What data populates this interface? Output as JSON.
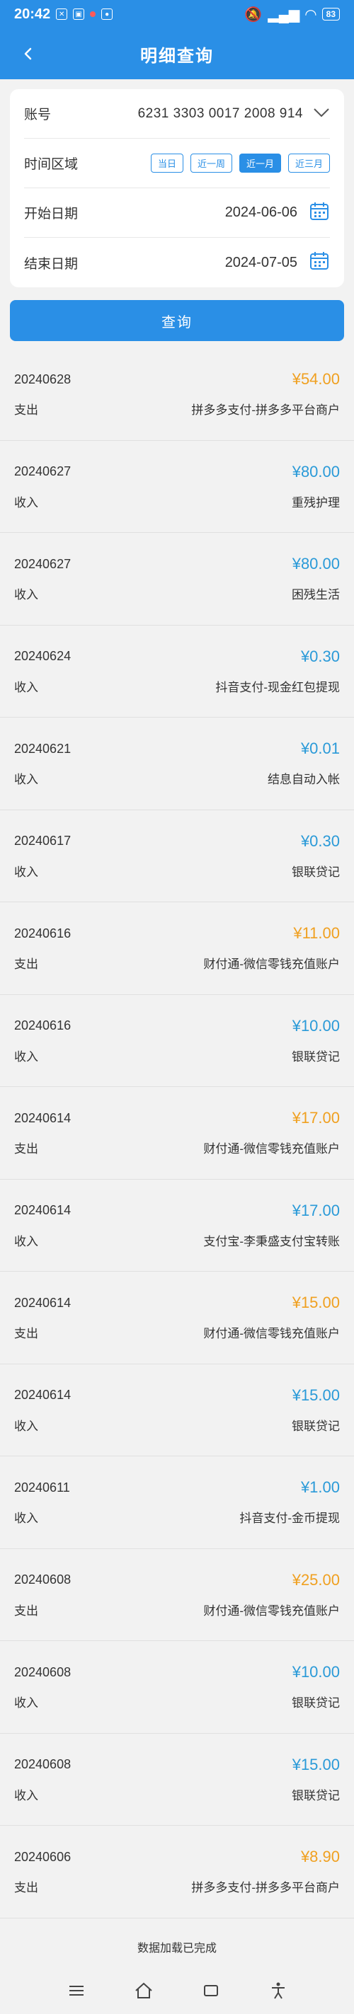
{
  "status_bar": {
    "time": "20:42",
    "battery": "83"
  },
  "header": {
    "title": "明细查询"
  },
  "form": {
    "account_label": "账号",
    "account_value": "6231 3303 0017 2008 914",
    "range_label": "时间区域",
    "range_options": [
      "当日",
      "近一周",
      "近一月",
      "近三月"
    ],
    "range_selected": "近一月",
    "start_label": "开始日期",
    "start_value": "2024-06-06",
    "end_label": "结束日期",
    "end_value": "2024-07-05"
  },
  "query_button": "查询",
  "transactions": [
    {
      "date": "20240628",
      "amount": "¥54.00",
      "direction": "out",
      "type": "支出",
      "desc": "拼多多支付-拼多多平台商户"
    },
    {
      "date": "20240627",
      "amount": "¥80.00",
      "direction": "in",
      "type": "收入",
      "desc": "重残护理"
    },
    {
      "date": "20240627",
      "amount": "¥80.00",
      "direction": "in",
      "type": "收入",
      "desc": "困残生活"
    },
    {
      "date": "20240624",
      "amount": "¥0.30",
      "direction": "in",
      "type": "收入",
      "desc": "抖音支付-现金红包提现"
    },
    {
      "date": "20240621",
      "amount": "¥0.01",
      "direction": "in",
      "type": "收入",
      "desc": "结息自动入帐"
    },
    {
      "date": "20240617",
      "amount": "¥0.30",
      "direction": "in",
      "type": "收入",
      "desc": "银联贷记"
    },
    {
      "date": "20240616",
      "amount": "¥11.00",
      "direction": "out",
      "type": "支出",
      "desc": "财付通-微信零钱充值账户"
    },
    {
      "date": "20240616",
      "amount": "¥10.00",
      "direction": "in",
      "type": "收入",
      "desc": "银联贷记"
    },
    {
      "date": "20240614",
      "amount": "¥17.00",
      "direction": "out",
      "type": "支出",
      "desc": "财付通-微信零钱充值账户"
    },
    {
      "date": "20240614",
      "amount": "¥17.00",
      "direction": "in",
      "type": "收入",
      "desc": "支付宝-李秉盛支付宝转账"
    },
    {
      "date": "20240614",
      "amount": "¥15.00",
      "direction": "out",
      "type": "支出",
      "desc": "财付通-微信零钱充值账户"
    },
    {
      "date": "20240614",
      "amount": "¥15.00",
      "direction": "in",
      "type": "收入",
      "desc": "银联贷记"
    },
    {
      "date": "20240611",
      "amount": "¥1.00",
      "direction": "in",
      "type": "收入",
      "desc": "抖音支付-金币提现"
    },
    {
      "date": "20240608",
      "amount": "¥25.00",
      "direction": "out",
      "type": "支出",
      "desc": "财付通-微信零钱充值账户"
    },
    {
      "date": "20240608",
      "amount": "¥10.00",
      "direction": "in",
      "type": "收入",
      "desc": "银联贷记"
    },
    {
      "date": "20240608",
      "amount": "¥15.00",
      "direction": "in",
      "type": "收入",
      "desc": "银联贷记"
    },
    {
      "date": "20240606",
      "amount": "¥8.90",
      "direction": "out",
      "type": "支出",
      "desc": "拼多多支付-拼多多平台商户"
    }
  ],
  "load_done": "数据加载已完成",
  "colors": {
    "primary": "#2a8fe6",
    "expense": "#f0a020",
    "income": "#2a9ad8"
  },
  "icons": [
    "back-arrow-icon",
    "chevron-down-icon",
    "calendar-icon",
    "menu-icon",
    "home-icon",
    "switch-icon",
    "accessibility-icon"
  ]
}
